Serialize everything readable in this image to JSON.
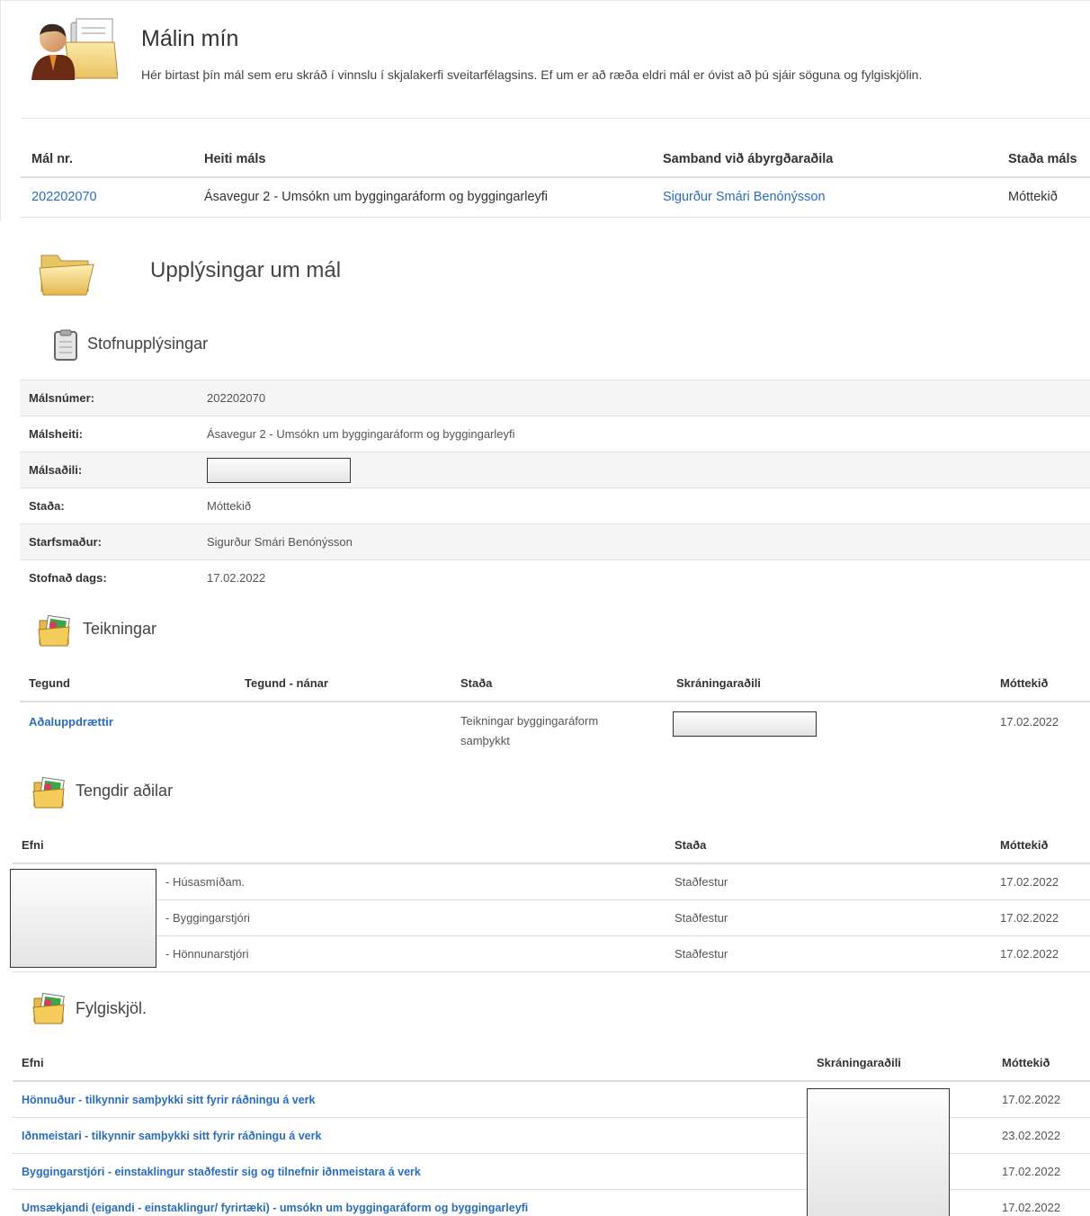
{
  "top": {
    "title": "Málin mín",
    "description": "Hér birtast þín mál sem eru skráð í vinnslu í skjalakerfi sveitarfélagsins. Ef um er að ræða eldri mál er óvist að þú sjáir söguna og fylgiskjölin.",
    "table": {
      "headers": [
        "Mál nr.",
        "Heiti máls",
        "Samband við ábyrgðaraðila",
        "Staða máls"
      ],
      "row": {
        "number": "202202070",
        "name": "Ásavegur 2 - Umsókn um byggingaráform og byggingarleyfi",
        "contact": "Sigurður Smári Benónýsson",
        "status": "Móttekið"
      }
    }
  },
  "case_info": {
    "title": "Upplýsingar um mál",
    "basic_title": "Stofnupplýsingar",
    "rows": [
      {
        "label": "Málsnúmer:",
        "value": "202202070"
      },
      {
        "label": "Málsheiti:",
        "value": "Ásavegur 2 - Umsókn um byggingaráform og byggingarleyfi"
      },
      {
        "label": "Málsaðili:",
        "value": ""
      },
      {
        "label": "Staða:",
        "value": "Móttekið"
      },
      {
        "label": "Starfsmaður:",
        "value": "Sigurður Smári Benónýsson"
      },
      {
        "label": "Stofnað dags:",
        "value": "17.02.2022"
      }
    ]
  },
  "drawings": {
    "title": "Teikningar",
    "headers": [
      "Tegund",
      "Tegund - nánar",
      "Staða",
      "Skráningaraðili",
      "Móttekið"
    ],
    "row": {
      "type": "Aðaluppdrættir",
      "type_detail": "",
      "status": "Teikningar byggingaráform samþykkt",
      "received": "17.02.2022"
    }
  },
  "related": {
    "title": "Tengdir aðilar",
    "headers": [
      "Efni",
      "Staða",
      "Móttekið"
    ],
    "rows": [
      {
        "role": "- Húsasmíðam.",
        "status": "Staðfestur",
        "received": "17.02.2022"
      },
      {
        "role": "- Byggingarstjóri",
        "status": "Staðfestur",
        "received": "17.02.2022"
      },
      {
        "role": "- Hönnunarstjóri",
        "status": "Staðfestur",
        "received": "17.02.2022"
      }
    ]
  },
  "attachments": {
    "title": "Fylgiskjöl.",
    "headers": [
      "Efni",
      "Skráningaraðili",
      "Móttekið"
    ],
    "rows": [
      {
        "name": "Hönnuður - tilkynnir samþykki sitt fyrir ráðningu á verk",
        "received": "17.02.2022"
      },
      {
        "name": "Iðnmeistari - tilkynnir samþykki sitt fyrir ráðningu á verk",
        "received": "23.02.2022"
      },
      {
        "name": "Byggingarstjóri - einstaklingur staðfestir sig og tilnefnir iðnmeistara á verk",
        "received": "17.02.2022"
      },
      {
        "name": "Umsækjandi (eigandi - einstaklingur/ fyrirtæki) - umsókn um byggingaráform og byggingarleyfi",
        "received": "17.02.2022"
      }
    ]
  },
  "icons": {
    "top": "person-folder-icon",
    "case_info": "open-folder-icon",
    "basic": "clipboard-icon",
    "sections": "pictures-folder-icon"
  }
}
